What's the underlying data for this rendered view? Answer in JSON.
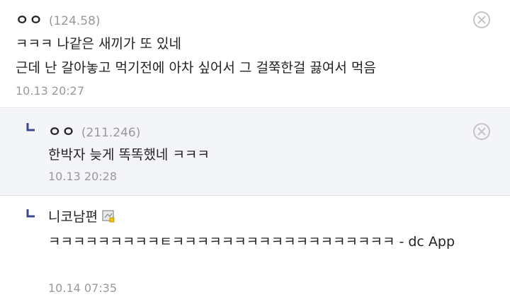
{
  "comments": [
    {
      "nickname": "ㅇㅇ",
      "ip": "(124.58)",
      "lines": [
        "ㅋㅋㅋ 나같은 새끼가 또 있네",
        "근데 난 갈아놓고 먹기전에 아차 싶어서 그 걸쭉한걸 끓여서 먹음"
      ],
      "date": "10.13 20:27",
      "delete_icon": "close-circle-icon"
    },
    {
      "nickname": "ㅇㅇ",
      "ip": "(211.246)",
      "lines": [
        "한박자 늦게 똑똑했네 ㅋㅋㅋ"
      ],
      "date": "10.13 20:28",
      "delete_icon": "close-circle-icon",
      "reply_icon": "reply-arrow-icon"
    },
    {
      "nickname": "니코남편",
      "member_icon": "gallery-member-icon",
      "text": "ㅋㅋㅋㅋㅋㅋㅋㅋㅋㅌㅋㅋㅋㅋㅋㅋㅋㅋㅋㅋㅋㅋㅋㅋㅋㅋㅋㅋ - dc App",
      "date": "10.14 07:35",
      "reply_icon": "reply-arrow-icon"
    }
  ],
  "colors": {
    "reply_background": "#f4f5f8",
    "reply_mark": "#3b4890",
    "meta_gray": "#999999"
  }
}
